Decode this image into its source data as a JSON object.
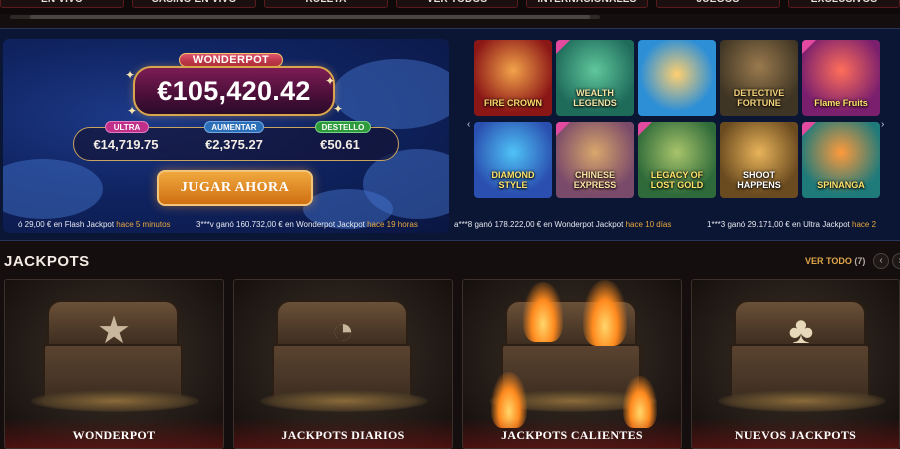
{
  "nav": {
    "tabs": [
      "EN VIVO",
      "CASINO EN VIVO",
      "RULETA",
      "VER TODOS",
      "INTERNACIONALES",
      "JUEGOS",
      "EXCLUSIVOS"
    ]
  },
  "hero": {
    "wonderpot_label": "WONDERPOT",
    "wonderpot_amount": "€105,420.42",
    "tiers": [
      {
        "name": "ULTRA",
        "value": "€14,719.75",
        "color": "#c0308a"
      },
      {
        "name": "AUMENTAR",
        "value": "€2,375.27",
        "color": "#2b6fb8"
      },
      {
        "name": "DESTELLO",
        "value": "€50.61",
        "color": "#2d9b3b"
      }
    ],
    "play_button": "JUGAR AHORA"
  },
  "games": {
    "prev_arrow": "‹",
    "next_arrow": "›",
    "items": [
      {
        "name": "FIRE CROWN",
        "bg": "#8b1616",
        "new": false
      },
      {
        "name": "WEALTH LEGENDS",
        "bg": "#1f6b5a",
        "new": true
      },
      {
        "name": "",
        "bg": "#2d8fd6",
        "new": false
      },
      {
        "name": "DETECTIVE FORTUNE",
        "bg": "#3f3524",
        "new": false
      },
      {
        "name": "Flame Fruits",
        "bg": "#7a1f6e",
        "new": true
      },
      {
        "name": "DIAMOND STYLE",
        "bg": "#2a4fb0",
        "new": false
      },
      {
        "name": "CHINESE EXPRESS",
        "bg": "#7a4a6a",
        "new": true
      },
      {
        "name": "LEGACY OF LOST GOLD",
        "bg": "#2f6b3a",
        "new": true
      },
      {
        "name": "SHOOT HAPPENS",
        "bg": "#6a4a1f",
        "new": false
      },
      {
        "name": "SPINANGA",
        "bg": "#1f7a7a",
        "new": true
      }
    ]
  },
  "ticker": [
    {
      "text": "ó 29,00 € en Flash Jackpot",
      "time": "hace 5 minutos"
    },
    {
      "text": "3***v ganó 160.732,00 € en Wonderpot Jackpot",
      "time": "hace 19 horas"
    },
    {
      "text": "a***8 ganó 178.222,00 € en Wonderpot Jackpot",
      "time": "hace 10 días"
    },
    {
      "text": "1***3 ganó 29.171,00 € en Ultra Jackpot",
      "time": "hace 2"
    }
  ],
  "jackpots": {
    "title": "JACKPOTS",
    "view_all": "VER TODO",
    "count": "(7)",
    "prev": "‹",
    "next": "›",
    "cards": [
      {
        "label": "WONDERPOT",
        "emblem": "★"
      },
      {
        "label": "JACKPOTS DIARIOS",
        "emblem": "◔"
      },
      {
        "label": "JACKPOTS CALIENTES",
        "emblem": ""
      },
      {
        "label": "NUEVOS JACKPOTS",
        "emblem": "♣"
      }
    ]
  }
}
